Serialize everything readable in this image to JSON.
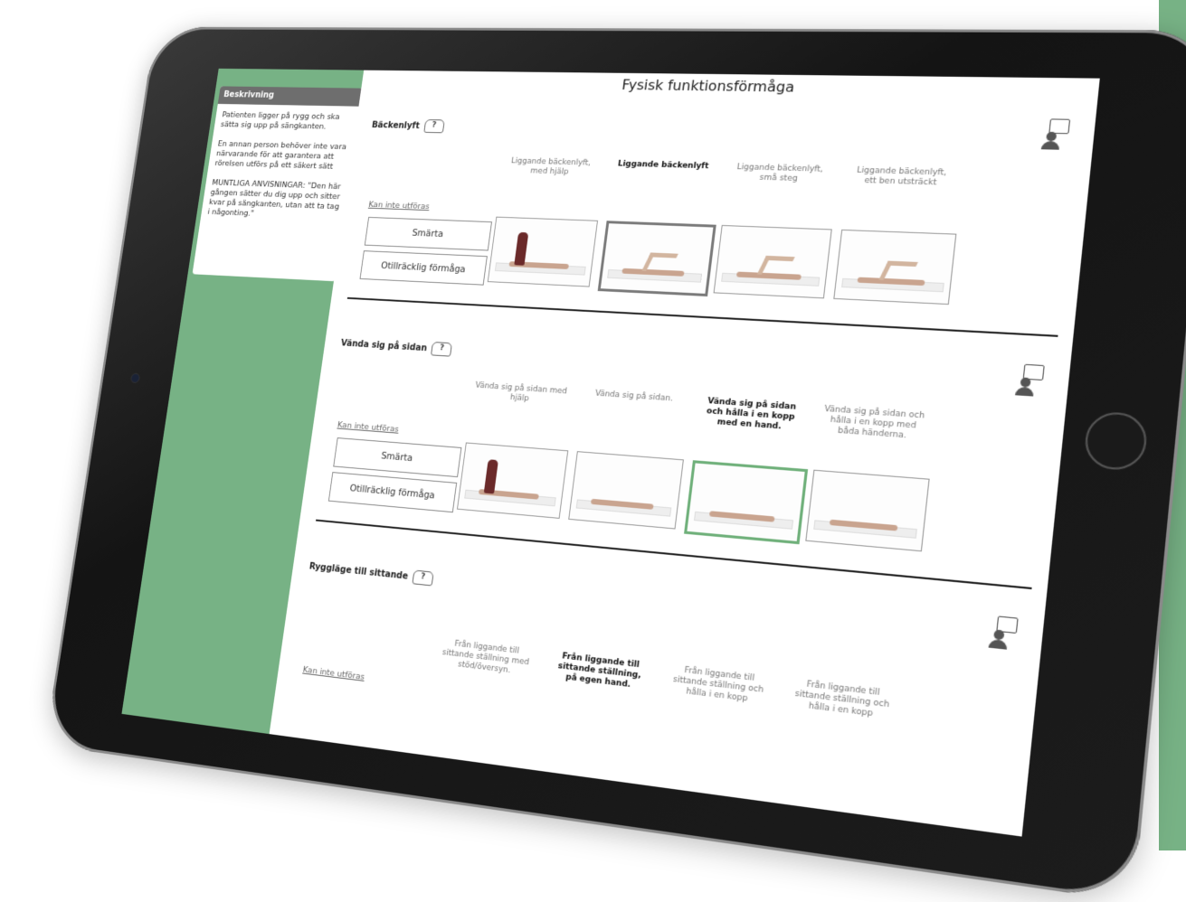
{
  "colors": {
    "accent_green": "#77b285",
    "selected_gray": "#7a7a7a",
    "selected_green": "#6fb07a"
  },
  "page_title": "Fysisk funktionsförmåga",
  "sidebar": {
    "header": "Beskrivning",
    "paragraphs": [
      "Patienten ligger på rygg och ska sätta sig upp på sängkanten.",
      "En annan person behöver inte vara närvarande för att garantera att rörelsen utförs på ett säkert sätt",
      "MUNTLIGA ANVISNINGAR: \"Den här gången sätter du dig upp och sitter kvar på sängkanten, utan att ta tag i någonting.\""
    ]
  },
  "help_icon_text": "?",
  "sections": [
    {
      "title": "Bäckenlyft",
      "link": "Kan inte utföras",
      "buttons": [
        "Smärta",
        "Otillräcklig förmåga"
      ],
      "options": [
        {
          "label": "Liggande bäckenlyft, med hjälp",
          "selected": false
        },
        {
          "label": "Liggande bäckenlyft",
          "selected": true
        },
        {
          "label": "Liggande bäckenlyft, små steg",
          "selected": false
        },
        {
          "label": "Liggande bäckenlyft, ett ben utsträckt",
          "selected": false
        }
      ]
    },
    {
      "title": "Vända sig på sidan",
      "link": "Kan inte utföras",
      "buttons": [
        "Smärta",
        "Otillräcklig förmåga"
      ],
      "options": [
        {
          "label": "Vända sig på sidan med hjälp",
          "selected": false
        },
        {
          "label": "Vända sig på sidan.",
          "selected": false
        },
        {
          "label": "Vända sig på sidan och hålla i en kopp med en hand.",
          "selected": true
        },
        {
          "label": "Vända sig på sidan och hålla i en kopp med båda händerna.",
          "selected": false
        }
      ]
    },
    {
      "title": "Ryggläge till sittande",
      "link": "Kan inte utföras",
      "options": [
        {
          "label": "Från liggande till sittande ställning med stöd/översyn.",
          "selected": false
        },
        {
          "label": "Från liggande till sittande ställning, på egen hand.",
          "selected": true
        },
        {
          "label": "Från liggande till sittande ställning och hålla i en kopp",
          "selected": false
        },
        {
          "label": "Från liggande till sittande ställning och hålla i en kopp",
          "selected": false
        }
      ]
    }
  ]
}
